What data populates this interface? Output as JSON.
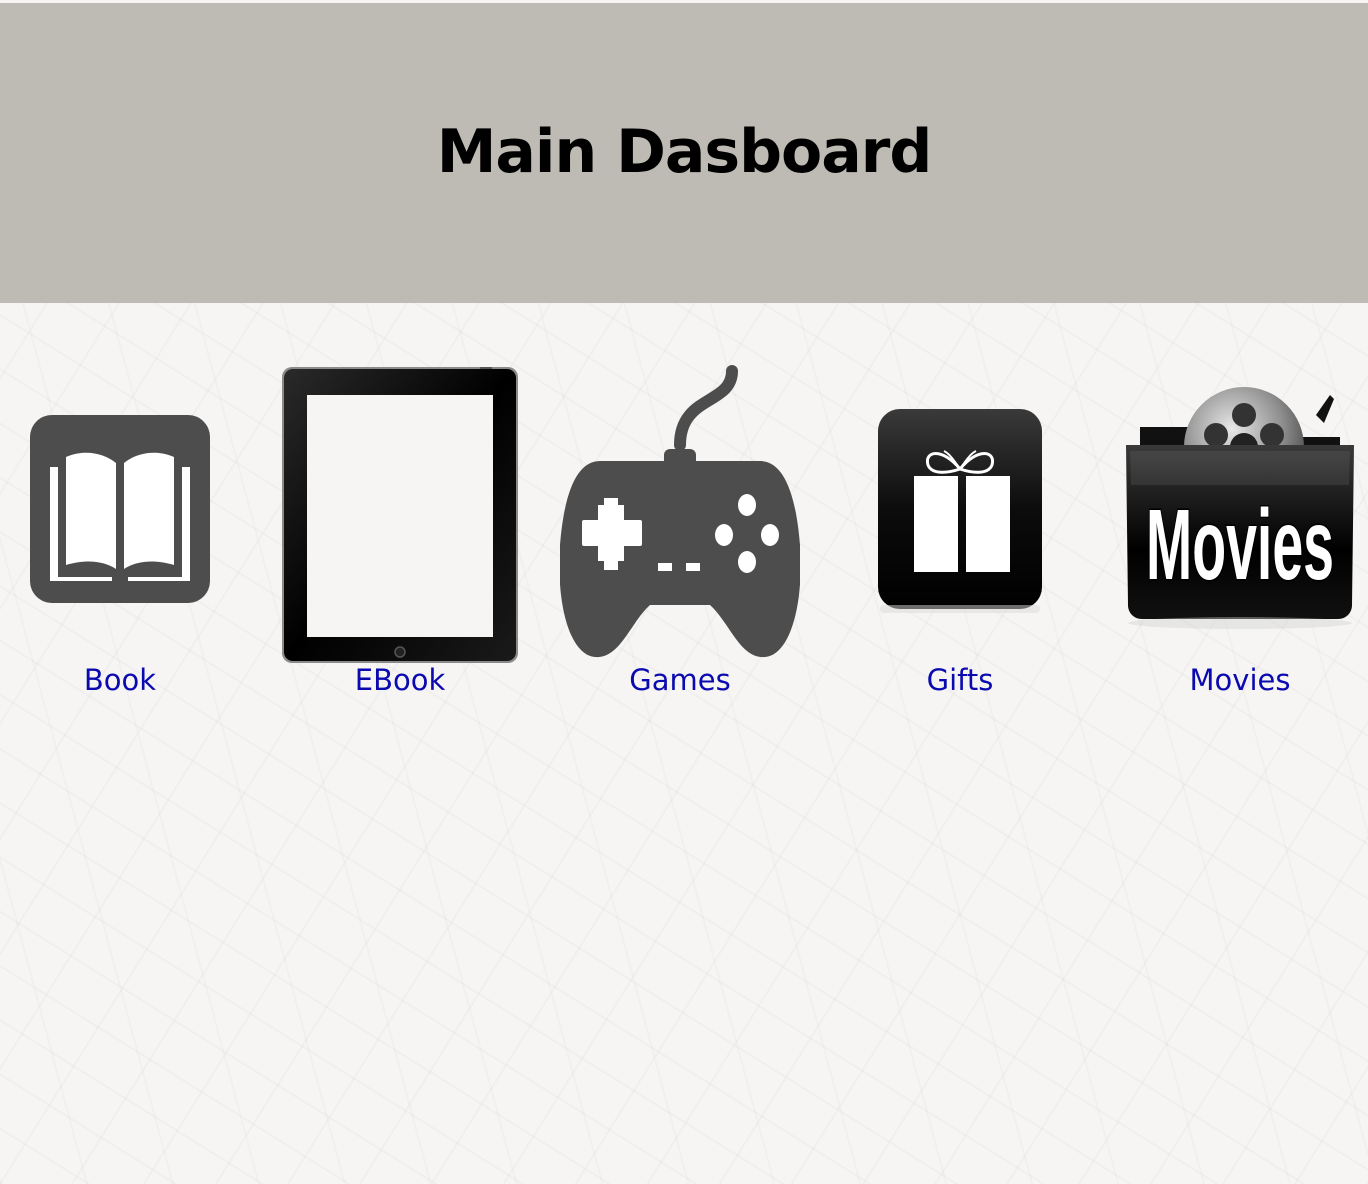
{
  "header": {
    "title": "Main Dasboard",
    "background_color": "#bebab4"
  },
  "tiles": [
    {
      "label": "Book",
      "icon": "open-book-icon"
    },
    {
      "label": "EBook",
      "icon": "tablet-icon"
    },
    {
      "label": "Games",
      "icon": "gamepad-icon"
    },
    {
      "label": "Gifts",
      "icon": "gift-icon"
    },
    {
      "label": "Movies",
      "icon": "movie-reel-icon",
      "icon_text": "Movies"
    }
  ],
  "colors": {
    "link": "#0a0ab0",
    "page_background": "#f6f5f3",
    "icon_dark": "#4d4d4d"
  }
}
